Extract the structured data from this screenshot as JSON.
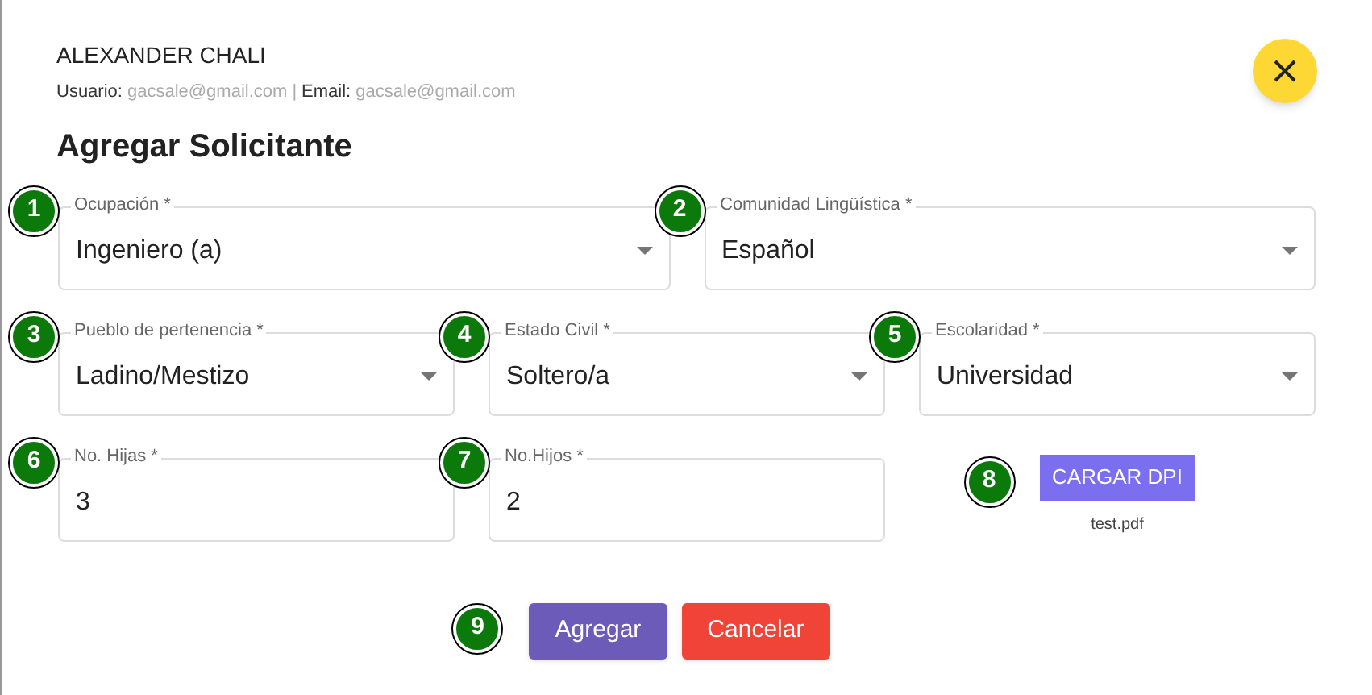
{
  "header": {
    "name": "ALEXANDER CHALI",
    "user_label": "Usuario:",
    "user_value": "gacsale@gmail.com",
    "separator": "|",
    "email_label": "Email:",
    "email_value": "gacsale@gmail.com"
  },
  "title": "Agregar Solicitante",
  "rows": [
    [
      {
        "kind": "select",
        "badge": "1",
        "label": "Ocupación *",
        "value": "Ingeniero (a)"
      },
      {
        "kind": "select",
        "badge": "2",
        "label": "Comunidad Lingüística *",
        "value": "Español"
      }
    ],
    [
      {
        "kind": "select",
        "badge": "3",
        "label": "Pueblo de pertenencia *",
        "value": "Ladino/Mestizo"
      },
      {
        "kind": "select",
        "badge": "4",
        "label": "Estado Civil *",
        "value": "Soltero/a"
      },
      {
        "kind": "select",
        "badge": "5",
        "label": "Escolaridad *",
        "value": "Universidad"
      }
    ],
    [
      {
        "kind": "text",
        "badge": "6",
        "label": "No. Hijas *",
        "value": "3"
      },
      {
        "kind": "text",
        "badge": "7",
        "label": "No.Hijos *",
        "value": "2"
      },
      {
        "kind": "upload",
        "badge": "8",
        "button": "CARGAR DPI",
        "file": "test.pdf"
      }
    ]
  ],
  "actions": {
    "badge": "9",
    "buttons": [
      {
        "kind": "primary",
        "label": "Agregar"
      },
      {
        "kind": "danger",
        "label": "Cancelar"
      }
    ]
  }
}
